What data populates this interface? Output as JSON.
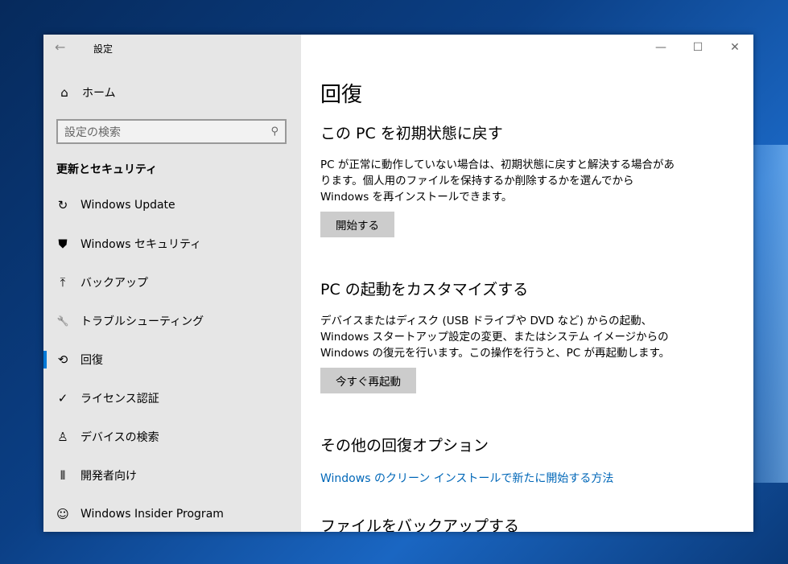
{
  "window": {
    "title": "設定",
    "back": "←",
    "minimize": "—",
    "maximize": "☐",
    "close": "✕"
  },
  "sidebar": {
    "home": "ホーム",
    "search_placeholder": "設定の検索",
    "category": "更新とセキュリティ",
    "items": [
      {
        "label": "Windows Update",
        "icon": "↻"
      },
      {
        "label": "Windows セキュリティ",
        "icon": "⛊"
      },
      {
        "label": "バックアップ",
        "icon": "⤒"
      },
      {
        "label": "トラブルシューティング",
        "icon": "🔧"
      },
      {
        "label": "回復",
        "icon": "⟲"
      },
      {
        "label": "ライセンス認証",
        "icon": "✓"
      },
      {
        "label": "デバイスの検索",
        "icon": "♙"
      },
      {
        "label": "開発者向け",
        "icon": "⫴"
      },
      {
        "label": "Windows Insider Program",
        "icon": "☺"
      }
    ]
  },
  "main": {
    "title": "回復",
    "reset": {
      "heading": "この PC を初期状態に戻す",
      "text": "PC が正常に動作していない場合は、初期状態に戻すと解決する場合があります。個人用のファイルを保持するか削除するかを選んでから Windows を再インストールできます。",
      "button": "開始する"
    },
    "startup": {
      "heading": "PC の起動をカスタマイズする",
      "text": "デバイスまたはディスク (USB ドライブや DVD など) からの起動、Windows スタートアップ設定の変更、またはシステム イメージからの Windows の復元を行います。この操作を行うと、PC が再起動します。",
      "button": "今すぐ再起動"
    },
    "other": {
      "heading": "その他の回復オプション",
      "link": "Windows のクリーン インストールで新たに開始する方法"
    },
    "backup": {
      "heading": "ファイルをバックアップする"
    }
  }
}
